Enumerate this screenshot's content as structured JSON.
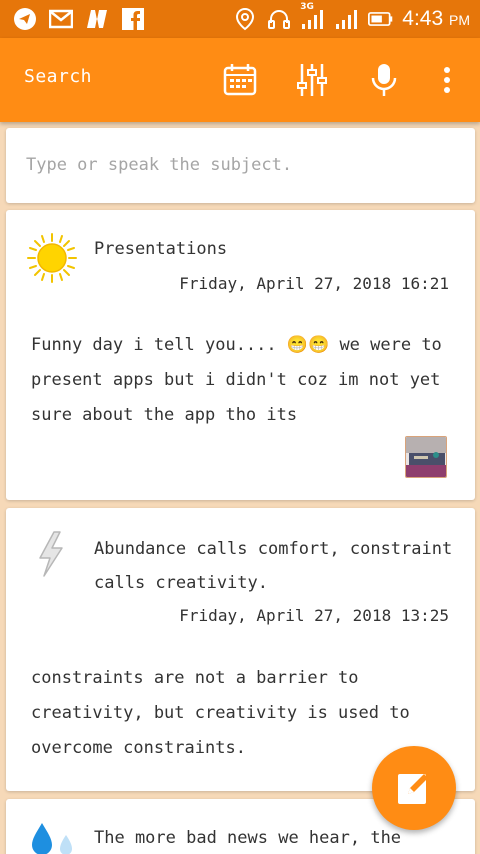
{
  "status_bar": {
    "time": "4:43",
    "ampm": "PM",
    "network": "3G",
    "icons": [
      "telegram-icon",
      "gmail-icon",
      "news-icon",
      "facebook-icon",
      "location-icon",
      "headset-icon",
      "signal-3g-icon",
      "signal-icon",
      "battery-icon"
    ]
  },
  "app_bar": {
    "title": "Search",
    "actions": [
      "calendar-icon",
      "filter-sliders-icon",
      "microphone-icon",
      "more-vert-icon"
    ]
  },
  "search": {
    "placeholder": "Type or speak the subject."
  },
  "entries": [
    {
      "icon": "sun-icon",
      "title": "Presentations",
      "date": "Friday, April 27, 2018 16:21",
      "body": "Funny day i tell you.... 😁😁 we were to present apps but i didn't coz im not yet sure about the app tho its",
      "has_thumbnail": true
    },
    {
      "icon": "lightning-icon",
      "title": "Abundance calls comfort, constraint calls creativity.",
      "date": "Friday, April 27, 2018 13:25",
      "body": "constraints are not a barrier to creativity, but creativity is used to overcome constraints."
    },
    {
      "icon": "water-drops-icon",
      "title": "The more bad news we hear, the"
    }
  ],
  "fab": {
    "icon": "edit-icon"
  },
  "colors": {
    "status_bar": "#E6760A",
    "app_bar": "#FF8C14",
    "background": "#F6D9B8",
    "card": "#FFFFFF",
    "text": "#333333",
    "placeholder": "#A5A5A5"
  }
}
